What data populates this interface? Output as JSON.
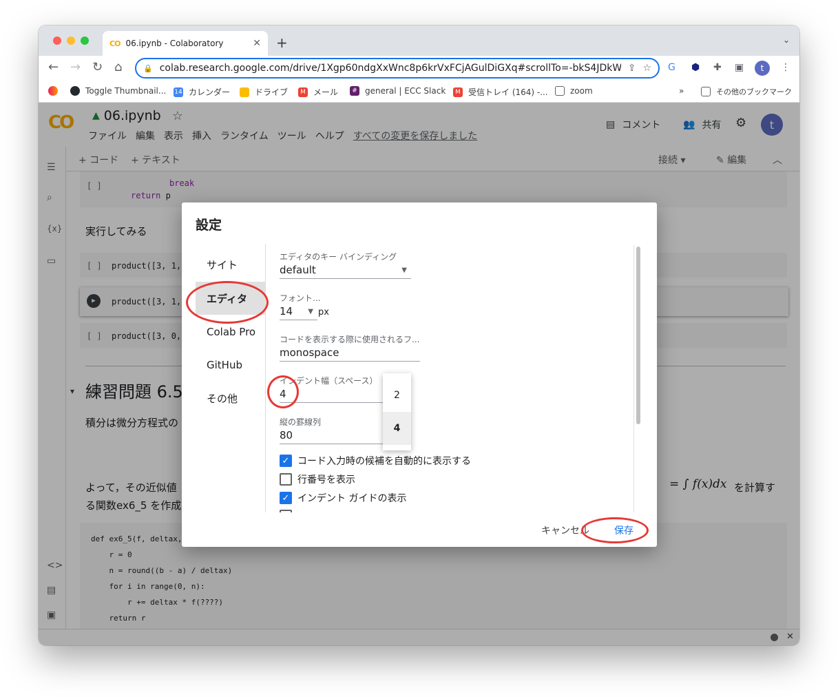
{
  "browser": {
    "tab_title": "06.ipynb - Colaboratory",
    "tab_favicon": "CO",
    "new_tab": "+",
    "url": "colab.research.google.com/drive/1Xgp60ndgXxWnc8p6krVxFCjAGulDiGXq#scrollTo=-bkS4JDkW...",
    "avatar": "t"
  },
  "bookmarks": [
    {
      "label": "Toggle Thumbnail...",
      "icon": "github-icon"
    },
    {
      "label": "カレンダー",
      "icon": "calendar-icon"
    },
    {
      "label": "ドライブ",
      "icon": "drive-icon"
    },
    {
      "label": "メール",
      "icon": "gmail-icon"
    },
    {
      "label": "general | ECC Slack",
      "icon": "slack-icon"
    },
    {
      "label": "受信トレイ (164) -...",
      "icon": "gmail-icon"
    },
    {
      "label": "zoom",
      "icon": "folder-icon"
    },
    {
      "label": "その他のブックマーク",
      "icon": "folder-icon"
    }
  ],
  "colab": {
    "logo": "CO",
    "notebook_title": "06.ipynb",
    "menu": [
      "ファイル",
      "編集",
      "表示",
      "挿入",
      "ランタイム",
      "ツール",
      "ヘルプ"
    ],
    "saved_status": "すべての変更を保存しました",
    "comment": "コメント",
    "share": "共有",
    "avatar": "t",
    "add_code": "+ コード",
    "add_text": "+ テキスト",
    "connect": "接続",
    "edit": "編集"
  },
  "notebook": {
    "code_top_break": "break",
    "code_top_return_kw": "return",
    "code_top_return_val": " p",
    "text_run": "実行してみる",
    "cell_1": "product([3, 1,",
    "cell_2": "product([3, 1,",
    "cell_3": "product([3, 0,",
    "heading": "練習問題 6.5",
    "para_1": "積分は微分方程式の",
    "para_2": "よって，その近似値",
    "para_2_end": "を計算す",
    "para_3": "る関数ex6_5 を作成",
    "formula": "= ∫ f(x)dx",
    "code_lines": [
      "def ex6_5(f, deltax,",
      "    r = 0",
      "    n = round((b - a) / deltax)",
      "    for i in range(0, n):",
      "        r += deltax * f(????)",
      "    return r"
    ],
    "bracket": "[ ]"
  },
  "dialog": {
    "title": "設定",
    "nav": [
      "サイト",
      "エディタ",
      "Colab Pro",
      "GitHub",
      "その他"
    ],
    "active_nav": "エディタ",
    "keybinding_label": "エディタのキー バインディング",
    "keybinding_value": "default",
    "font_label": "フォント...",
    "font_size": "14",
    "font_unit": "px",
    "codefont_label": "コードを表示する際に使用されるフ...",
    "codefont_value": "monospace",
    "indent_label": "インデント幅（スペース）",
    "indent_value": "4",
    "indent_options": [
      "2",
      "4"
    ],
    "ruler_label": "縦の罫線列",
    "ruler_value": "80",
    "checkboxes": [
      {
        "label": "コード入力時の候補を自動的に表示する",
        "checked": true
      },
      {
        "label": "行番号を表示",
        "checked": false
      },
      {
        "label": "インデント ガイドの表示",
        "checked": true
      }
    ],
    "cancel": "キャンセル",
    "save": "保存"
  },
  "colors": {
    "accent": "#1a73e8",
    "annotation": "#e53935",
    "colab_orange": "#f9ab00"
  }
}
